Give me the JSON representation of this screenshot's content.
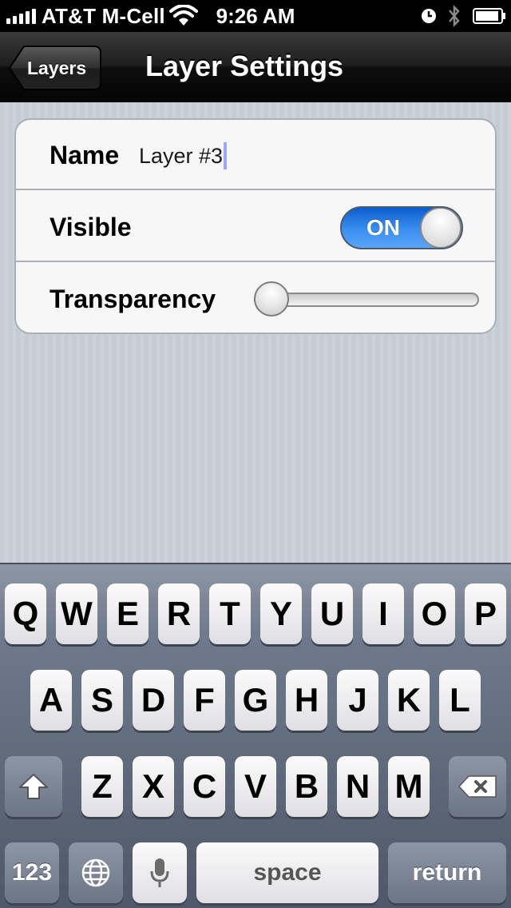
{
  "status_bar": {
    "carrier": "AT&T M-Cell",
    "time": "9:26 AM",
    "signal_bars": 5
  },
  "nav": {
    "back_label": "Layers",
    "title": "Layer Settings"
  },
  "settings": {
    "name_label": "Name",
    "name_value": "Layer #3",
    "visible_label": "Visible",
    "visible_toggle_label": "ON",
    "visible_on": true,
    "transparency_label": "Transparency",
    "transparency_value": 0
  },
  "keyboard": {
    "row1": [
      "Q",
      "W",
      "E",
      "R",
      "T",
      "Y",
      "U",
      "I",
      "O",
      "P"
    ],
    "row2": [
      "A",
      "S",
      "D",
      "F",
      "G",
      "H",
      "J",
      "K",
      "L"
    ],
    "row3": [
      "Z",
      "X",
      "C",
      "V",
      "B",
      "N",
      "M"
    ],
    "numbers_label": "123",
    "space_label": "space",
    "return_label": "return",
    "icons": [
      "shift-icon",
      "delete-icon",
      "globe-icon",
      "microphone-icon"
    ]
  },
  "colors": {
    "toggle_on": "#3b8ff0",
    "nav_bar": "#1e1e1e",
    "background": "#c5ccd4"
  }
}
